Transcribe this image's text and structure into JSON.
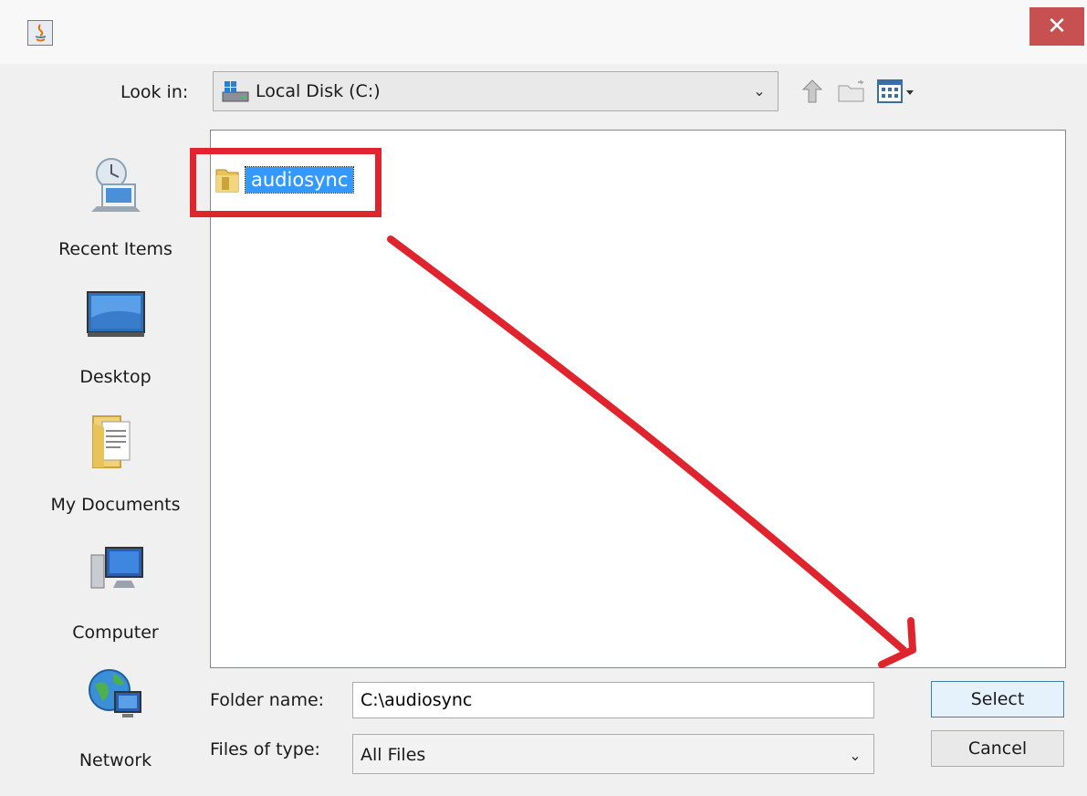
{
  "dialog": {
    "close_glyph": "✕"
  },
  "toolbar": {
    "look_in_label": "Look in:",
    "look_in_value": "Local Disk (C:)"
  },
  "sidebar": {
    "items": [
      {
        "label": "Recent Items",
        "icon": "recent-items-icon"
      },
      {
        "label": "Desktop",
        "icon": "desktop-icon"
      },
      {
        "label": "My Documents",
        "icon": "documents-folder-icon"
      },
      {
        "label": "Computer",
        "icon": "computer-icon"
      },
      {
        "label": "Network",
        "icon": "network-icon"
      }
    ]
  },
  "files": [
    {
      "name": "audiosync",
      "selected": true
    }
  ],
  "form": {
    "folder_name_label": "Folder name:",
    "folder_name_value": "C:\\audiosync",
    "file_type_label": "Files of type:",
    "file_type_value": "All Files"
  },
  "buttons": {
    "select": "Select",
    "cancel": "Cancel"
  },
  "annotation": {
    "color": "#e0242e"
  },
  "colors": {
    "selection": "#3399ff",
    "close": "#c75050"
  }
}
